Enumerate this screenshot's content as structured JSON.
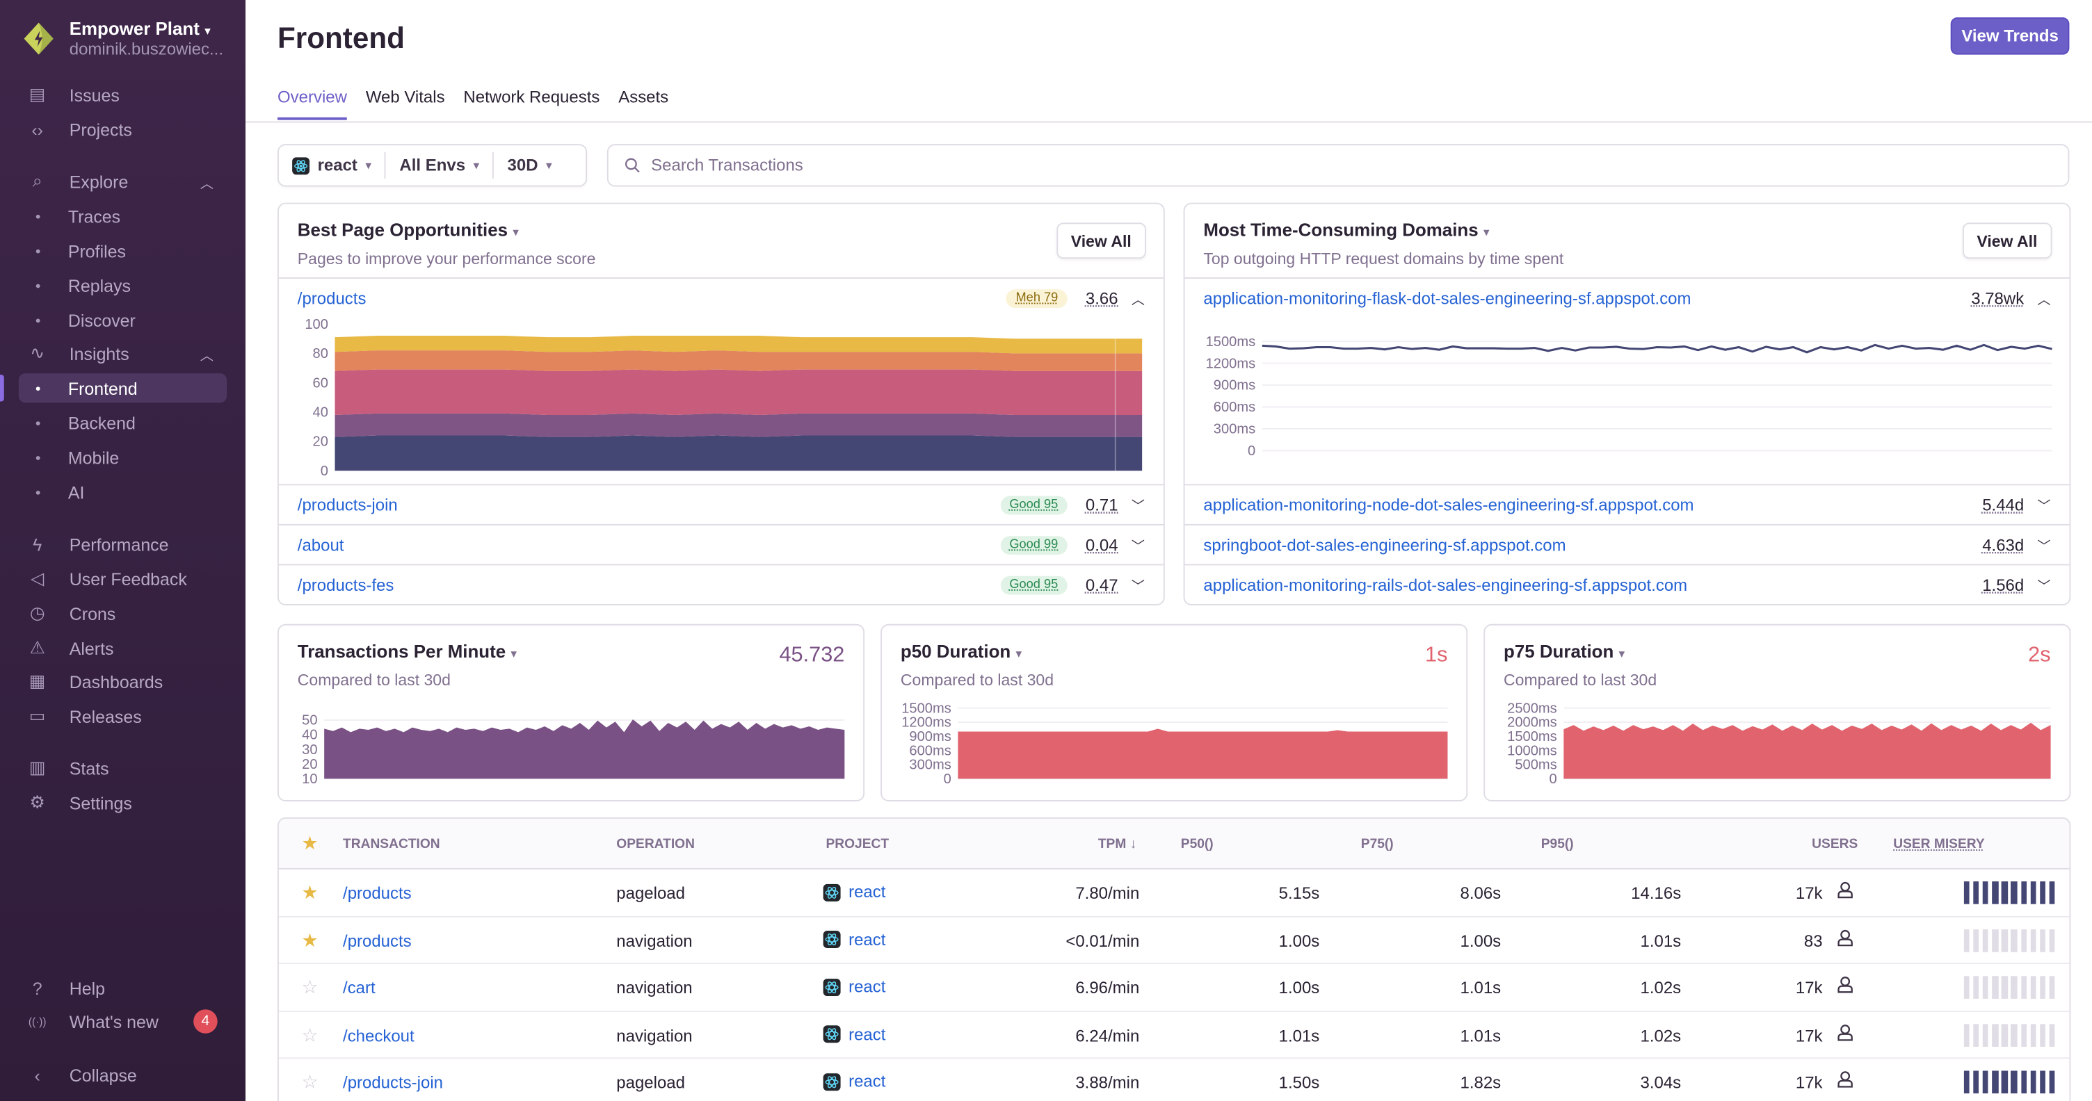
{
  "sidebar": {
    "org_name": "Empower Plant",
    "org_user": "dominik.buszowiec...",
    "items": [
      {
        "label": "Issues",
        "icon": "inbox-icon"
      },
      {
        "label": "Projects",
        "icon": "folder-code-icon"
      },
      {
        "label": "Explore",
        "icon": "search-icon"
      },
      {
        "label": "Traces"
      },
      {
        "label": "Profiles"
      },
      {
        "label": "Replays"
      },
      {
        "label": "Discover"
      },
      {
        "label": "Insights",
        "icon": "graph-icon"
      },
      {
        "label": "Frontend"
      },
      {
        "label": "Backend"
      },
      {
        "label": "Mobile"
      },
      {
        "label": "AI"
      },
      {
        "label": "Performance",
        "icon": "lightning-icon"
      },
      {
        "label": "User Feedback",
        "icon": "megaphone-icon"
      },
      {
        "label": "Crons",
        "icon": "clock-icon"
      },
      {
        "label": "Alerts",
        "icon": "siren-icon"
      },
      {
        "label": "Dashboards",
        "icon": "dashboard-icon"
      },
      {
        "label": "Releases",
        "icon": "releases-icon"
      },
      {
        "label": "Stats",
        "icon": "stats-icon"
      },
      {
        "label": "Settings",
        "icon": "gear-icon"
      },
      {
        "label": "Help",
        "icon": "question-icon"
      },
      {
        "label": "What's new",
        "icon": "broadcast-icon",
        "badge": "4"
      },
      {
        "label": "Collapse",
        "icon": "chevron-left-icon"
      }
    ],
    "active": "Frontend"
  },
  "header": {
    "title": "Frontend",
    "view_trends": "View Trends",
    "tabs": [
      "Overview",
      "Web Vitals",
      "Network Requests",
      "Assets"
    ],
    "active_tab": "Overview"
  },
  "filters": {
    "project": "react",
    "env": "All Envs",
    "period": "30D",
    "search_placeholder": "Search Transactions"
  },
  "best_pages": {
    "title": "Best Page Opportunities",
    "subtitle": "Pages to improve your performance score",
    "view_all": "View All",
    "rows": [
      {
        "page": "/products",
        "badge": "Meh 79",
        "badge_type": "meh",
        "value": "3.66",
        "expanded": true
      },
      {
        "page": "/products-join",
        "badge": "Good 95",
        "badge_type": "good",
        "value": "0.71"
      },
      {
        "page": "/about",
        "badge": "Good 99",
        "badge_type": "good",
        "value": "0.04"
      },
      {
        "page": "/products-fes",
        "badge": "Good 95",
        "badge_type": "good",
        "value": "0.47"
      }
    ]
  },
  "domains": {
    "title": "Most Time-Consuming Domains",
    "subtitle": "Top outgoing HTTP request domains by time spent",
    "view_all": "View All",
    "rows": [
      {
        "domain": "application-monitoring-flask-dot-sales-engineering-sf.appspot.com",
        "value": "3.78wk",
        "expanded": true
      },
      {
        "domain": "application-monitoring-node-dot-sales-engineering-sf.appspot.com",
        "value": "5.44d"
      },
      {
        "domain": "springboot-dot-sales-engineering-sf.appspot.com",
        "value": "4.63d"
      },
      {
        "domain": "application-monitoring-rails-dot-sales-engineering-sf.appspot.com",
        "value": "1.56d"
      }
    ]
  },
  "tpm": {
    "title": "Transactions Per Minute",
    "subtitle": "Compared to last 30d",
    "value": "45.732",
    "color": "#7a5185"
  },
  "p50": {
    "title": "p50 Duration",
    "subtitle": "Compared to last 30d",
    "value": "1s",
    "color": "#e0636e"
  },
  "p75": {
    "title": "p75 Duration",
    "subtitle": "Compared to last 30d",
    "value": "2s",
    "color": "#e0636e"
  },
  "chart_data": [
    {
      "type": "area",
      "stacked": true,
      "yticks": [
        "100",
        "80",
        "60",
        "40",
        "20",
        "0"
      ],
      "ylim": [
        0,
        100
      ],
      "colors": [
        "#444674",
        "#7f5585",
        "#c75c7c",
        "#e2845c",
        "#e8b944"
      ],
      "series": [
        {
          "values": [
            23,
            24,
            24,
            24,
            24,
            23,
            23,
            24,
            23,
            24,
            23,
            24,
            24,
            24,
            24,
            24,
            23,
            23,
            23,
            23
          ]
        },
        {
          "values": [
            15,
            15,
            15,
            15,
            15,
            15,
            15,
            15,
            15,
            15,
            15,
            15,
            15,
            15,
            15,
            15,
            15,
            15,
            15,
            15
          ]
        },
        {
          "values": [
            30,
            30,
            30,
            30,
            30,
            30,
            30,
            30,
            30,
            30,
            30,
            30,
            30,
            30,
            30,
            30,
            30,
            30,
            30,
            30
          ]
        },
        {
          "values": [
            13,
            13,
            13,
            13,
            13,
            13,
            13,
            13,
            13,
            13,
            13,
            12,
            12,
            12,
            12,
            12,
            12,
            12,
            12,
            12
          ]
        },
        {
          "values": [
            10,
            10,
            10,
            10,
            10,
            10,
            10,
            10,
            11,
            10,
            11,
            10,
            10,
            10,
            10,
            10,
            10,
            10,
            10,
            10
          ]
        }
      ]
    },
    {
      "type": "line",
      "yticks": [
        "1500ms",
        "1200ms",
        "900ms",
        "600ms",
        "300ms",
        "0"
      ],
      "ylim": [
        0,
        1500
      ],
      "color": "#444674",
      "values": [
        1440,
        1430,
        1400,
        1405,
        1420,
        1420,
        1400,
        1400,
        1410,
        1390,
        1420,
        1395,
        1410,
        1385,
        1430,
        1405,
        1405,
        1405,
        1400,
        1400,
        1410,
        1370,
        1410,
        1375,
        1415,
        1415,
        1425,
        1400,
        1395,
        1420,
        1415,
        1430,
        1380,
        1430,
        1385,
        1420,
        1360,
        1425,
        1390,
        1420,
        1350,
        1420,
        1390,
        1420,
        1375,
        1450,
        1400,
        1440,
        1400,
        1410,
        1385,
        1440,
        1385,
        1450,
        1380,
        1425,
        1400,
        1440,
        1395
      ]
    },
    {
      "type": "area",
      "yticks": [
        "50",
        "40",
        "30",
        "20",
        "10"
      ],
      "ylim": [
        0,
        55
      ],
      "color": "#7a5185",
      "values": [
        43,
        41,
        44,
        40,
        43,
        42,
        44,
        41,
        43,
        40,
        44,
        42,
        41,
        43,
        40,
        44,
        42,
        43,
        41,
        44,
        42,
        43,
        40,
        44,
        42,
        45,
        41,
        46,
        43,
        48,
        42,
        50,
        44,
        49,
        40,
        51,
        45,
        50,
        41,
        48,
        44,
        49,
        42,
        50,
        43,
        47,
        44,
        49,
        42,
        48,
        43,
        47,
        44,
        46,
        43,
        45,
        42,
        44,
        43,
        42
      ]
    },
    {
      "type": "area",
      "yticks": [
        "1500ms",
        "1200ms",
        "900ms",
        "600ms",
        "300ms",
        "0"
      ],
      "ylim": [
        0,
        1500
      ],
      "color": "#e0636e",
      "values": [
        1000,
        1000,
        1000,
        1000,
        1000,
        1000,
        1000,
        1000,
        1000,
        1000,
        1000,
        1000,
        1000,
        1000,
        1000,
        1000,
        1000,
        1000,
        1000,
        1000,
        1060,
        1000,
        1000,
        1000,
        1000,
        1000,
        1000,
        1000,
        1000,
        1000,
        1000,
        1000,
        1000,
        1000,
        1000,
        1000,
        1000,
        1000,
        1030,
        1000,
        1000,
        1000,
        1000,
        1000,
        1000,
        1000,
        1000,
        1000,
        1000,
        1000
      ]
    },
    {
      "type": "area",
      "yticks": [
        "2500ms",
        "2000ms",
        "1500ms",
        "1000ms",
        "500ms",
        "0"
      ],
      "ylim": [
        0,
        2500
      ],
      "color": "#e0636e",
      "values": [
        1750,
        1900,
        1700,
        1850,
        1720,
        1880,
        1700,
        1900,
        1750,
        1850,
        1720,
        1900,
        1700,
        1950,
        1720,
        1880,
        1760,
        1900,
        1700,
        1860,
        1740,
        1920,
        1700,
        1880,
        1720,
        1950,
        1740,
        1900,
        1700,
        1880,
        1760,
        1950,
        1720,
        1880,
        1740,
        1920,
        1700,
        1960,
        1720,
        1900,
        1740,
        1880,
        1700,
        1950,
        1720,
        1900,
        1740,
        1980,
        1720,
        1900
      ]
    }
  ],
  "table": {
    "headers": [
      "TRANSACTION",
      "OPERATION",
      "PROJECT",
      "TPM ↓",
      "P50()",
      "P75()",
      "P95()",
      "USERS",
      "USER MISERY"
    ],
    "rows": [
      {
        "starred": true,
        "transaction": "/products",
        "operation": "pageload",
        "project": "react",
        "tpm": "7.80/min",
        "p50": "5.15s",
        "p75": "8.06s",
        "p95": "14.16s",
        "users": "17k",
        "misery": 1
      },
      {
        "starred": true,
        "transaction": "/products",
        "operation": "navigation",
        "project": "react",
        "tpm": "<0.01/min",
        "p50": "1.00s",
        "p75": "1.00s",
        "p95": "1.01s",
        "users": "83",
        "misery": 0
      },
      {
        "starred": false,
        "transaction": "/cart",
        "operation": "navigation",
        "project": "react",
        "tpm": "6.96/min",
        "p50": "1.00s",
        "p75": "1.01s",
        "p95": "1.02s",
        "users": "17k",
        "misery": 0
      },
      {
        "starred": false,
        "transaction": "/checkout",
        "operation": "navigation",
        "project": "react",
        "tpm": "6.24/min",
        "p50": "1.01s",
        "p75": "1.01s",
        "p95": "1.02s",
        "users": "17k",
        "misery": 0
      },
      {
        "starred": false,
        "transaction": "/products-join",
        "operation": "pageload",
        "project": "react",
        "tpm": "3.88/min",
        "p50": "1.50s",
        "p75": "1.82s",
        "p95": "3.04s",
        "users": "17k",
        "misery": 1
      }
    ]
  }
}
